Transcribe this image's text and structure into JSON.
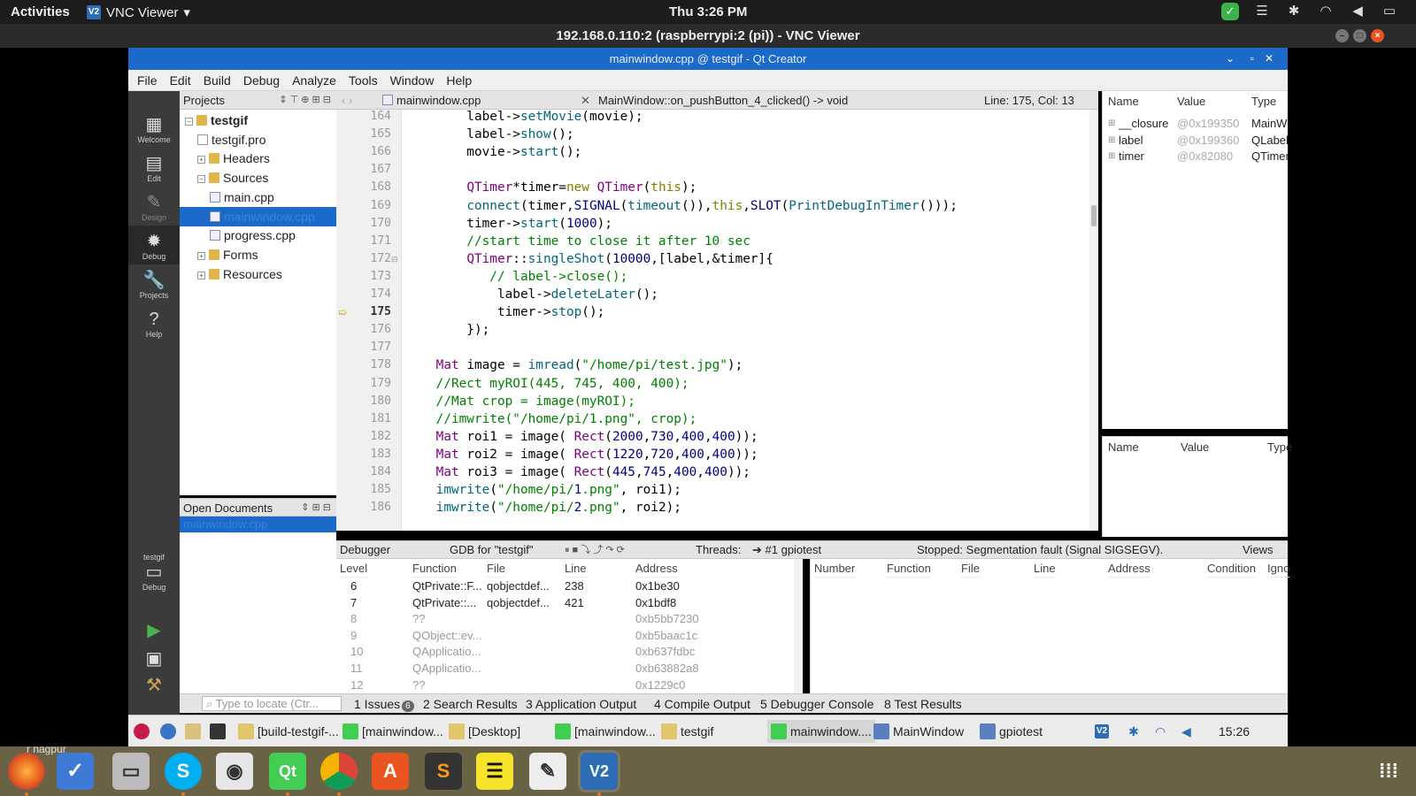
{
  "topbar": {
    "activities": "Activities",
    "app": "VNC Viewer",
    "clock": "Thu  3:26 PM"
  },
  "vnc": {
    "title": "192.168.0.110:2 (raspberrypi:2 (pi)) - VNC Viewer"
  },
  "qt": {
    "title": "mainwindow.cpp @ testgif - Qt Creator",
    "menu": [
      "File",
      "Edit",
      "Build",
      "Debug",
      "Analyze",
      "Tools",
      "Window",
      "Help"
    ],
    "modes": [
      "Welcome",
      "Edit",
      "Design",
      "Debug",
      "Projects",
      "Help"
    ],
    "kit": {
      "project": "testgif",
      "label": "Debug"
    }
  },
  "projects": {
    "header": "Projects",
    "tree": [
      {
        "label": "testgif",
        "level": 0,
        "kind": "root",
        "bold": true
      },
      {
        "label": "testgif.pro",
        "level": 1,
        "kind": "pro"
      },
      {
        "label": "Headers",
        "level": 1,
        "kind": "folder"
      },
      {
        "label": "Sources",
        "level": 1,
        "kind": "folder"
      },
      {
        "label": "main.cpp",
        "level": 2,
        "kind": "cpp"
      },
      {
        "label": "mainwindow.cpp",
        "level": 2,
        "kind": "cpp",
        "selected": true
      },
      {
        "label": "progress.cpp",
        "level": 2,
        "kind": "cpp"
      },
      {
        "label": "Forms",
        "level": 1,
        "kind": "folder"
      },
      {
        "label": "Resources",
        "level": 1,
        "kind": "folder"
      }
    ]
  },
  "open_documents": {
    "header": "Open Documents",
    "items": [
      "mainwindow.cpp"
    ]
  },
  "editor": {
    "file": "mainwindow.cpp",
    "function": "MainWindow::on_pushButton_4_clicked() -> void",
    "position": "Line: 175, Col: 13",
    "current_line": 175,
    "lines": [
      {
        "n": 164,
        "text": "        label->setMovie(movie);"
      },
      {
        "n": 165,
        "text": "        label->show();"
      },
      {
        "n": 166,
        "text": "        movie->start();"
      },
      {
        "n": 167,
        "text": ""
      },
      {
        "n": 168,
        "text": "        QTimer*timer=new QTimer(this);"
      },
      {
        "n": 169,
        "text": "        connect(timer,SIGNAL(timeout()),this,SLOT(PrintDebugInTimer()));"
      },
      {
        "n": 170,
        "text": "        timer->start(1000);"
      },
      {
        "n": 171,
        "text": "        //start time to close it after 10 sec"
      },
      {
        "n": 172,
        "text": "        QTimer::singleShot(10000,[label,&timer]{"
      },
      {
        "n": 173,
        "text": "           // label->close();"
      },
      {
        "n": 174,
        "text": "            label->deleteLater();"
      },
      {
        "n": 175,
        "text": "            timer->stop();"
      },
      {
        "n": 176,
        "text": "        });"
      },
      {
        "n": 177,
        "text": ""
      },
      {
        "n": 178,
        "text": "    Mat image = imread(\"/home/pi/test.jpg\");"
      },
      {
        "n": 179,
        "text": "    //Rect myROI(445, 745, 400, 400);"
      },
      {
        "n": 180,
        "text": "    //Mat crop = image(myROI);"
      },
      {
        "n": 181,
        "text": "    //imwrite(\"/home/pi/1.png\", crop);"
      },
      {
        "n": 182,
        "text": "    Mat roi1 = image( Rect(2000,730,400,400));"
      },
      {
        "n": 183,
        "text": "    Mat roi2 = image( Rect(1220,720,400,400));"
      },
      {
        "n": 184,
        "text": "    Mat roi3 = image( Rect(445,745,400,400));"
      },
      {
        "n": 185,
        "text": "    imwrite(\"/home/pi/1.png\", roi1);"
      },
      {
        "n": 186,
        "text": "    imwrite(\"/home/pi/2.png\", roi2);"
      }
    ]
  },
  "locals": {
    "headers": [
      "Name",
      "Value",
      "Type"
    ],
    "rows": [
      {
        "name": "__closure",
        "value": "@0x199350",
        "type": "MainWi"
      },
      {
        "name": "label",
        "value": "@0x199360",
        "type": "QLabel"
      },
      {
        "name": "timer",
        "value": "@0x82080",
        "type": "QTimer"
      }
    ]
  },
  "watch": {
    "headers": [
      "Name",
      "Value",
      "Type"
    ]
  },
  "debugger": {
    "mode": "Debugger",
    "engine": "GDB for \"testgif\"",
    "threads_label": "Threads:",
    "thread": "#1 gpiotest",
    "status": "Stopped: Segmentation fault (Signal SIGSEGV).",
    "views": "Views"
  },
  "stack": {
    "headers": [
      "Level",
      "Function",
      "File",
      "Line",
      "Address"
    ],
    "rows": [
      {
        "level": "6",
        "function": "QtPrivate::F...",
        "file": "qobjectdef...",
        "line": "238",
        "address": "0x1be30",
        "gray": false
      },
      {
        "level": "7",
        "function": "QtPrivate::...",
        "file": "qobjectdef...",
        "line": "421",
        "address": "0x1bdf8",
        "gray": false
      },
      {
        "level": "8",
        "function": "??",
        "file": "",
        "line": "",
        "address": "0xb5bb7230",
        "gray": true
      },
      {
        "level": "9",
        "function": "QObject::ev...",
        "file": "",
        "line": "",
        "address": "0xb5baac1c",
        "gray": true
      },
      {
        "level": "10",
        "function": "QApplicatio...",
        "file": "",
        "line": "",
        "address": "0xb637fdbc",
        "gray": true
      },
      {
        "level": "11",
        "function": "QApplicatio...",
        "file": "",
        "line": "",
        "address": "0xb63882a8",
        "gray": true
      },
      {
        "level": "12",
        "function": "??",
        "file": "",
        "line": "",
        "address": "0x1229c0",
        "gray": true
      }
    ]
  },
  "breakpoints": {
    "headers": [
      "Number",
      "Function",
      "File",
      "Line",
      "Address",
      "Condition",
      "Igno"
    ]
  },
  "output_tabs": {
    "locate_placeholder": "Type to locate (Ctr...",
    "tabs": [
      "1 Issues",
      "2 Search Results",
      "3 Application Output",
      "4 Compile Output",
      "5 Debugger Console",
      "8 Test Results"
    ],
    "issues_badge": "6"
  },
  "pi_taskbar": {
    "items": [
      "[build-testgif-...",
      "[mainwindow...",
      "[Desktop]",
      "[mainwindow...",
      "testgif",
      "mainwindow....",
      "MainWindow",
      "gpiotest"
    ],
    "clock": "15:26"
  },
  "dock": {
    "overlay_text": "r nagpur"
  }
}
